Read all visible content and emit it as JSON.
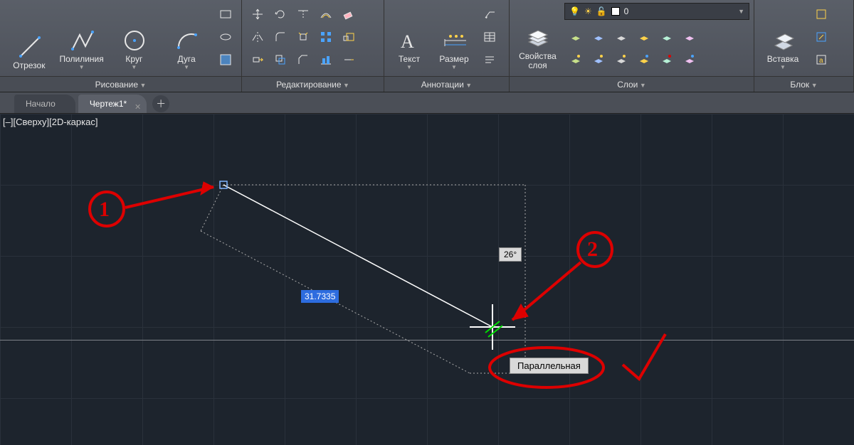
{
  "ribbon": {
    "draw": {
      "title": "Рисование",
      "line": "Отрезок",
      "polyline": "Полилиния",
      "circle": "Круг",
      "arc": "Дуга"
    },
    "modify": {
      "title": "Редактирование"
    },
    "annot": {
      "title": "Аннотации",
      "text": "Текст",
      "dim": "Размер"
    },
    "layers": {
      "title": "Слои",
      "props": "Свойства\nслоя",
      "current": "0"
    },
    "block": {
      "title": "Блок",
      "insert": "Вставка"
    }
  },
  "tabs": {
    "home": "Начало",
    "drawing": "Чертеж1*"
  },
  "view_label": "[‒][Сверху][2D-каркас]",
  "dyn": {
    "dist": "31.7335",
    "angle": "26°"
  },
  "snap_tip": "Параллельная",
  "callouts": {
    "one": "1",
    "two": "2"
  }
}
